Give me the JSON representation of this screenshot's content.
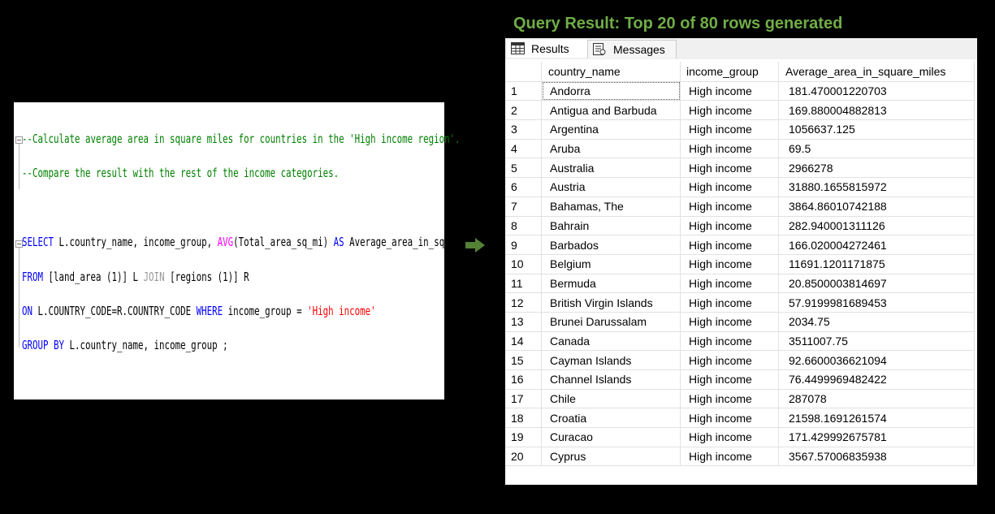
{
  "editor": {
    "line1_comment": "--Calculate average area in square miles for countries in the 'High income region'.",
    "line2_comment": "--Compare the result with the rest of the income categories.",
    "line3": {
      "kw_select": "SELECT",
      "cols": " L.country_name, income_group, ",
      "fn_avg": "AVG",
      "args": "(Total_area_sq_mi) ",
      "kw_as": "AS",
      "alias": " Average_area_in_square_miles"
    },
    "line4": {
      "kw_from": "FROM",
      "tbl1": " [land_area (1)] L ",
      "kw_join": "JOIN",
      "tbl2": " [regions (1)] R"
    },
    "line5": {
      "kw_on": "ON",
      "cond": " L.COUNTRY_CODE=R.COUNTRY_CODE ",
      "kw_where": "WHERE",
      "where_col": " income_group = ",
      "str_val": "'High income'"
    },
    "line6": {
      "kw_group": "GROUP BY",
      "cols": " L.country_name, income_group ;"
    }
  },
  "result_title": "Query Result: Top 20  of 80 rows generated",
  "tabs": {
    "results": "Results",
    "messages": "Messages"
  },
  "columns": [
    "country_name",
    "income_group",
    "Average_area_in_square_miles"
  ],
  "rows": [
    {
      "n": "1",
      "country": "Andorra",
      "income": "High income",
      "avg": "181.470001220703"
    },
    {
      "n": "2",
      "country": "Antigua and Barbuda",
      "income": "High income",
      "avg": "169.880004882813"
    },
    {
      "n": "3",
      "country": "Argentina",
      "income": "High income",
      "avg": "1056637.125"
    },
    {
      "n": "4",
      "country": "Aruba",
      "income": "High income",
      "avg": "69.5"
    },
    {
      "n": "5",
      "country": "Australia",
      "income": "High income",
      "avg": "2966278"
    },
    {
      "n": "6",
      "country": "Austria",
      "income": "High income",
      "avg": "31880.1655815972"
    },
    {
      "n": "7",
      "country": "Bahamas, The",
      "income": "High income",
      "avg": "3864.86010742188"
    },
    {
      "n": "8",
      "country": "Bahrain",
      "income": "High income",
      "avg": "282.940001311126"
    },
    {
      "n": "9",
      "country": "Barbados",
      "income": "High income",
      "avg": "166.020004272461"
    },
    {
      "n": "10",
      "country": "Belgium",
      "income": "High income",
      "avg": "11691.1201171875"
    },
    {
      "n": "11",
      "country": "Bermuda",
      "income": "High income",
      "avg": "20.8500003814697"
    },
    {
      "n": "12",
      "country": "British Virgin Islands",
      "income": "High income",
      "avg": "57.9199981689453"
    },
    {
      "n": "13",
      "country": "Brunei Darussalam",
      "income": "High income",
      "avg": "2034.75"
    },
    {
      "n": "14",
      "country": "Canada",
      "income": "High income",
      "avg": "3511007.75"
    },
    {
      "n": "15",
      "country": "Cayman Islands",
      "income": "High income",
      "avg": "92.6600036621094"
    },
    {
      "n": "16",
      "country": "Channel Islands",
      "income": "High income",
      "avg": "76.4499969482422"
    },
    {
      "n": "17",
      "country": "Chile",
      "income": "High income",
      "avg": "287078"
    },
    {
      "n": "18",
      "country": "Croatia",
      "income": "High income",
      "avg": "21598.1691261574"
    },
    {
      "n": "19",
      "country": "Curacao",
      "income": "High income",
      "avg": "171.429992675781"
    },
    {
      "n": "20",
      "country": "Cyprus",
      "income": "High income",
      "avg": "3567.57006835938"
    }
  ],
  "colors": {
    "title": "#70ad47",
    "arrow": "#548235",
    "comment": "#008000",
    "keyword": "#0000ff",
    "function": "#ff00ff",
    "string": "#ff0000"
  },
  "icons": [
    "results-grid-icon",
    "messages-icon",
    "right-arrow-icon"
  ]
}
